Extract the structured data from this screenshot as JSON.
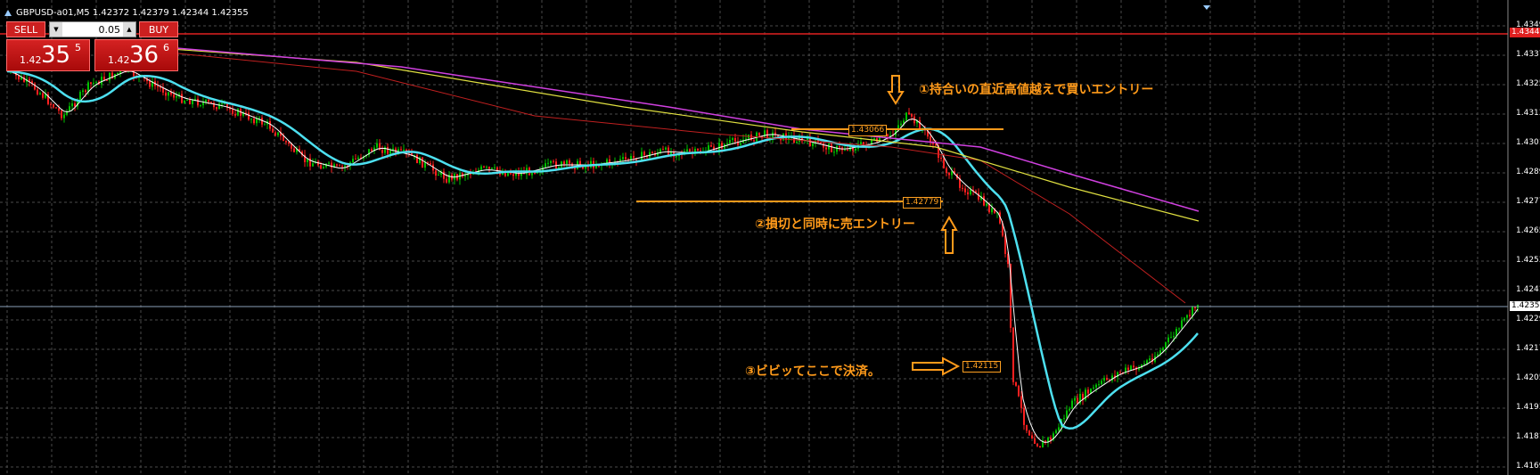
{
  "window": {
    "title": "GBPUSD-a01,M5  1.42372 1.42379 1.42344 1.42355"
  },
  "trade_panel": {
    "sell_label": "SELL",
    "buy_label": "BUY",
    "lot_value": "0.05",
    "sell_prefix": "1.42",
    "sell_big": "35",
    "sell_small": "5",
    "buy_prefix": "1.42",
    "buy_big": "36",
    "buy_small": "6"
  },
  "price_axis": {
    "labels": [
      "1.43490",
      "1.43370",
      "1.43250",
      "1.43130",
      "1.43010",
      "1.42890",
      "1.42770",
      "1.42650",
      "1.42530",
      "1.42410",
      "1.42290",
      "1.42170",
      "1.42050",
      "1.41930",
      "1.41810",
      "1.41690"
    ],
    "current_price": "1.42355",
    "red_line_price": "1.43440"
  },
  "annotations": {
    "note1": "①持合いの直近高値越えで買いエントリー",
    "note2": "②損切と同時に売エントリー",
    "note3": "③ビビッてここで決済。",
    "tag1": "1.43066",
    "tag2": "1.42779",
    "tag3": "1.42115"
  },
  "colors": {
    "background": "#000000",
    "grid": "#4a4a4a",
    "bull": "#00c000",
    "bear": "#ff2020",
    "ma_cyan": "#4de0f0",
    "ma_white": "#ffffff",
    "ma_yellow": "#e0e040",
    "ma_magenta": "#d040e0",
    "ma_red": "#c02020",
    "annotation": "#ff9a1a",
    "panel_red": "#cc2020"
  }
}
